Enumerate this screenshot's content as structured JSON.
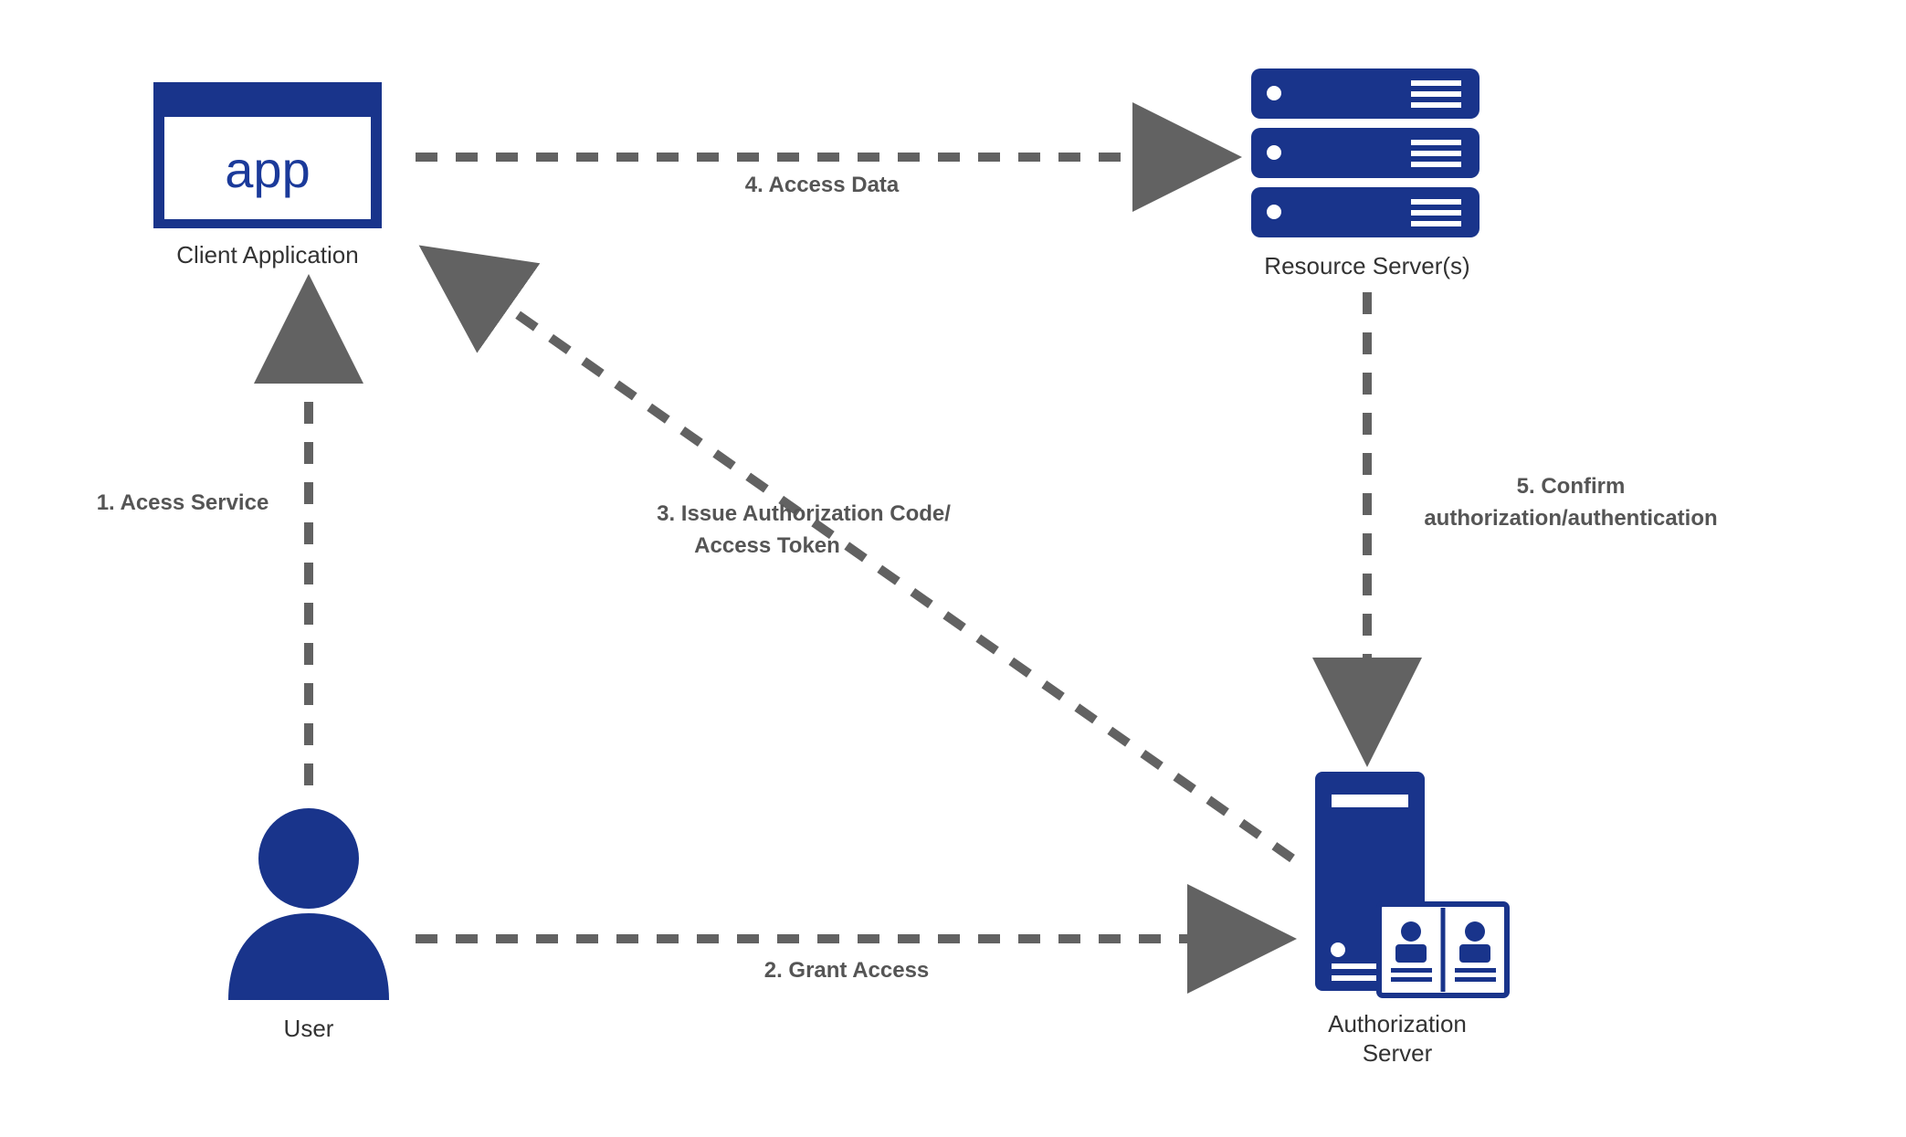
{
  "colors": {
    "brand": "#19348b",
    "arrow": "#626262",
    "text": "#555555"
  },
  "nodes": {
    "client": {
      "app_label": "app",
      "caption": "Client Application"
    },
    "user": {
      "caption": "User"
    },
    "resource": {
      "caption": "Resource Server(s)"
    },
    "auth": {
      "caption_line1": "Authorization",
      "caption_line2": "Server"
    }
  },
  "edges": {
    "e1": {
      "label": "1. Acess Service"
    },
    "e2": {
      "label": "2. Grant Access"
    },
    "e3": {
      "label_line1": "3. Issue Authorization Code/",
      "label_line2": "Access Token"
    },
    "e4": {
      "label": "4. Access Data"
    },
    "e5": {
      "label_line1": "5. Confirm",
      "label_line2": "authorization/authentication"
    }
  }
}
